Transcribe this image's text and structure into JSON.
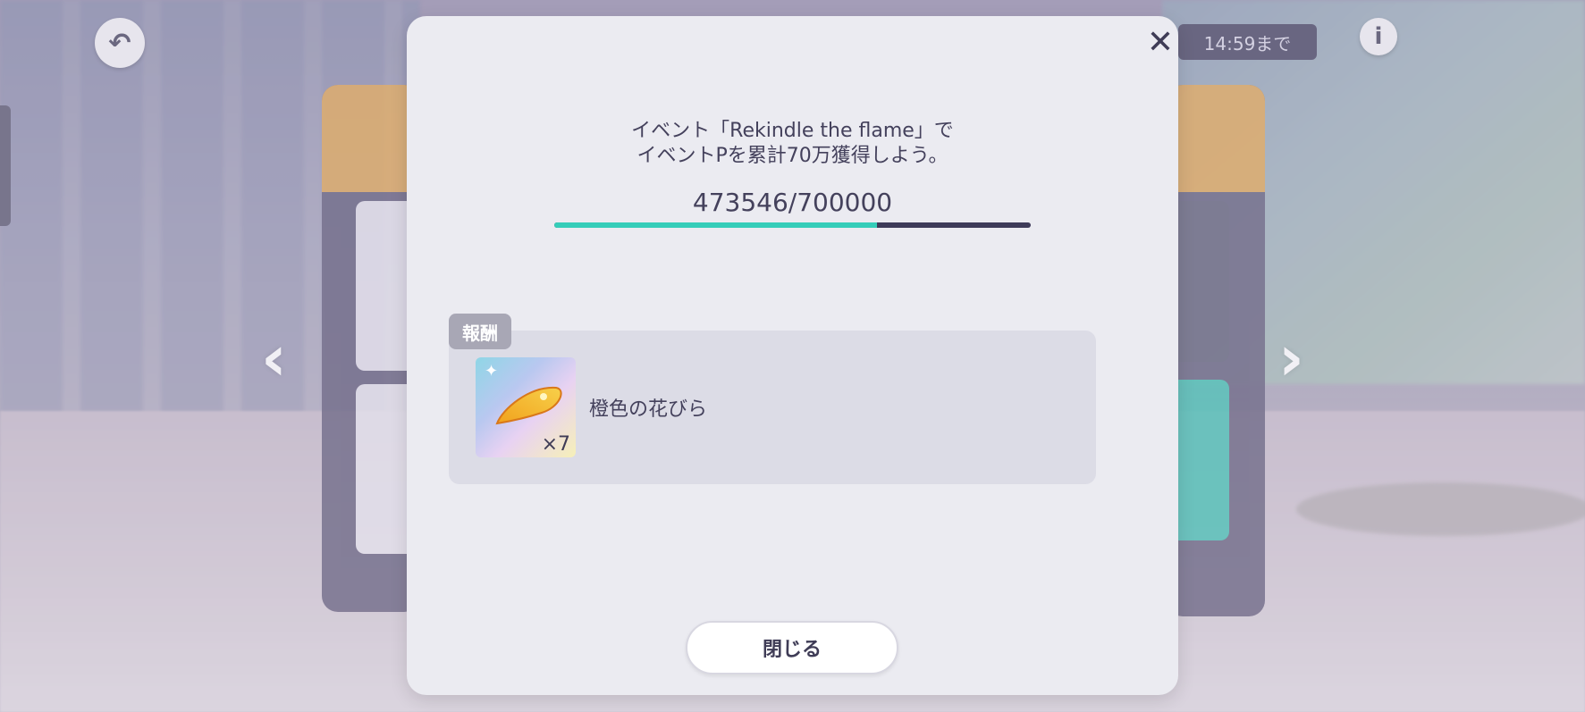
{
  "background": {
    "time_remaining": "14:59まで"
  },
  "modal": {
    "close_symbol": "✕",
    "mission_line1": "イベント「Rekindle the flame」で",
    "mission_line2": "イベントPを累計70万獲得しよう。",
    "progress_text": "473546/700000",
    "progress_current": 473546,
    "progress_goal": 700000,
    "reward": {
      "tag": "報酬",
      "item_name": "橙色の花びら",
      "quantity": "×7"
    },
    "close_button_label": "閉じる"
  },
  "colors": {
    "accent": "#35cdb9",
    "text": "#44415c",
    "modal_bg": "#ebebf1"
  }
}
